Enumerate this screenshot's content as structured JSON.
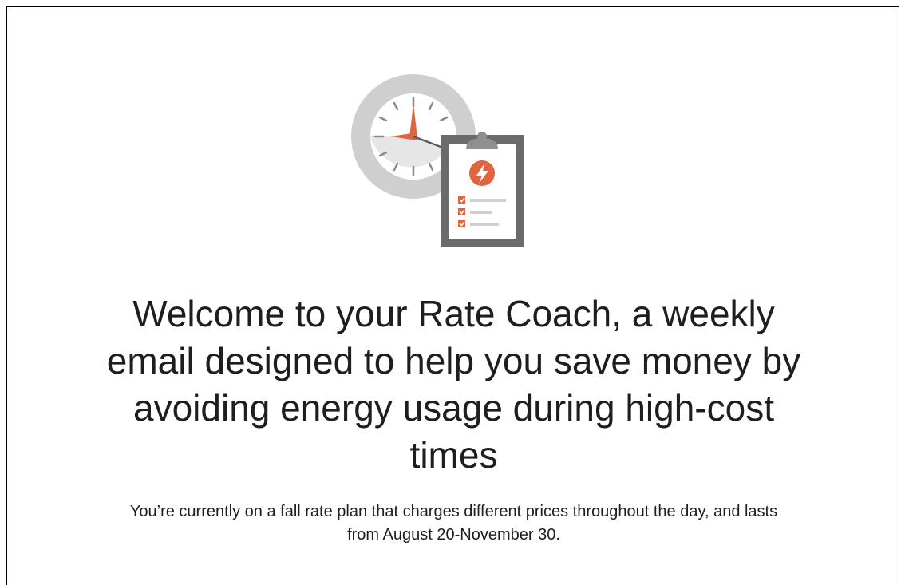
{
  "email": {
    "headline": "Welcome to your Rate Coach, a weekly email designed to help you save money by avoiding energy usage during high-cost times",
    "body_text": "You’re currently on a fall rate plan that charges different prices throughout the day, and lasts from August 20-November 30."
  },
  "illustration": {
    "clock_icon": "clock-icon",
    "clipboard_icon": "clipboard-checklist-icon",
    "bolt_icon": "lightning-bolt-icon",
    "colors": {
      "accent": "#e0643f",
      "clock_ring": "#cfcfcf",
      "clipboard_frame": "#6b6b6b",
      "ticks": "#8a8a8a"
    }
  }
}
